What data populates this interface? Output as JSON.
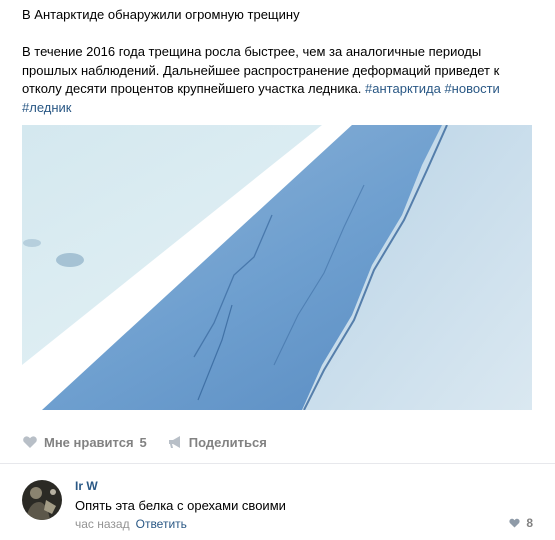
{
  "post": {
    "title": "В Антарктиде обнаружили огромную трещину",
    "text_main": "В течение 2016 года трещина росла быстрее, чем за аналогичные периоды прошлых наблюдений. Дальнейшее распространение деформаций приведет к отколу десяти процентов крупнейшего участка ледника.",
    "hashtags": [
      "#антарктида",
      "#новости",
      "#ледник"
    ]
  },
  "actions": {
    "like_label": "Мне нравится",
    "like_count": "5",
    "share_label": "Поделиться"
  },
  "comment": {
    "author": "Ir     W",
    "text": "Опять эта белка с орехами своими",
    "time": "час назад",
    "reply_label": "Ответить",
    "like_count": "8"
  },
  "colors": {
    "link": "#2a5885",
    "muted": "#828282",
    "divider": "#e7e8ec"
  },
  "icons": {
    "like": "heart-icon",
    "share": "megaphone-icon",
    "comment_like": "heart-icon"
  }
}
